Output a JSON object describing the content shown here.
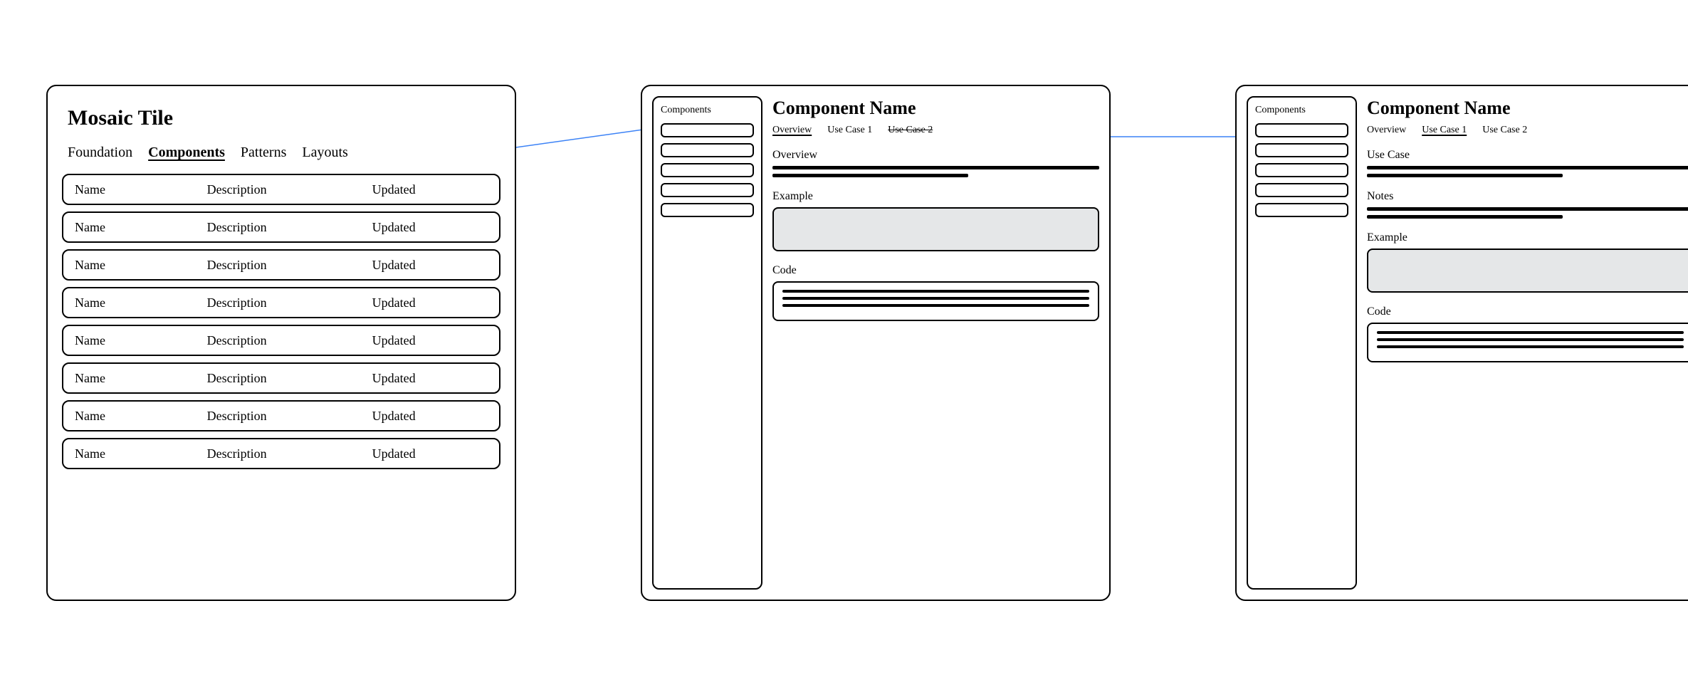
{
  "frame1": {
    "title": "Mosaic Tile",
    "tabs": [
      "Foundation",
      "Components",
      "Patterns",
      "Layouts"
    ],
    "active_tab_index": 1,
    "columns": {
      "name": "Name",
      "description": "Description",
      "updated": "Updated"
    },
    "rows": [
      {
        "name": "Name",
        "description": "Description",
        "updated": "Updated"
      },
      {
        "name": "Name",
        "description": "Description",
        "updated": "Updated"
      },
      {
        "name": "Name",
        "description": "Description",
        "updated": "Updated"
      },
      {
        "name": "Name",
        "description": "Description",
        "updated": "Updated"
      },
      {
        "name": "Name",
        "description": "Description",
        "updated": "Updated"
      },
      {
        "name": "Name",
        "description": "Description",
        "updated": "Updated"
      },
      {
        "name": "Name",
        "description": "Description",
        "updated": "Updated"
      },
      {
        "name": "Name",
        "description": "Description",
        "updated": "Updated"
      }
    ]
  },
  "frame2": {
    "sidebar_title": "Components",
    "sidebar_item_count": 5,
    "page_title": "Component Name",
    "subtabs": [
      {
        "label": "Overview",
        "state": "active"
      },
      {
        "label": "Use Case 1",
        "state": "normal"
      },
      {
        "label": "Use Case 2",
        "state": "strike"
      }
    ],
    "sections": {
      "overview": "Overview",
      "example": "Example",
      "code": "Code"
    }
  },
  "frame3": {
    "sidebar_title": "Components",
    "sidebar_item_count": 5,
    "page_title": "Component Name",
    "subtabs": [
      {
        "label": "Overview",
        "state": "normal"
      },
      {
        "label": "Use Case 1",
        "state": "active"
      },
      {
        "label": "Use Case 2",
        "state": "normal"
      }
    ],
    "sections": {
      "usecase": "Use Case",
      "notes": "Notes",
      "example": "Example",
      "code": "Code"
    }
  }
}
